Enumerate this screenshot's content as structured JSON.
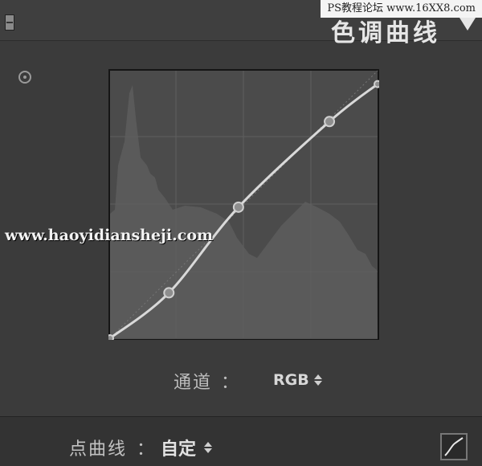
{
  "watermark_top": "PS教程论坛 www.16XX8.com",
  "watermark_center": "www.haoyidiansheji.com",
  "header": {
    "title": "色调曲线",
    "collapse_icon": "triangle-down-icon",
    "toggle_icon": "panel-toggle-icon"
  },
  "target_icon": "target-adjustment-icon",
  "curve": {
    "points": [
      [
        0,
        0
      ],
      [
        0.22,
        0.17
      ],
      [
        0.48,
        0.49
      ],
      [
        0.82,
        0.81
      ],
      [
        1,
        0.95
      ]
    ]
  },
  "channel": {
    "label": "通道",
    "colon": "：",
    "value": "RGB"
  },
  "point_curve": {
    "label": "点曲线",
    "colon": "：",
    "value": "自定"
  },
  "colors": {
    "panel_bg": "#3b3b3b",
    "graph_bg": "#4b4b4b",
    "histogram": "#5c5c5c",
    "curve": "#d9d9d9"
  }
}
